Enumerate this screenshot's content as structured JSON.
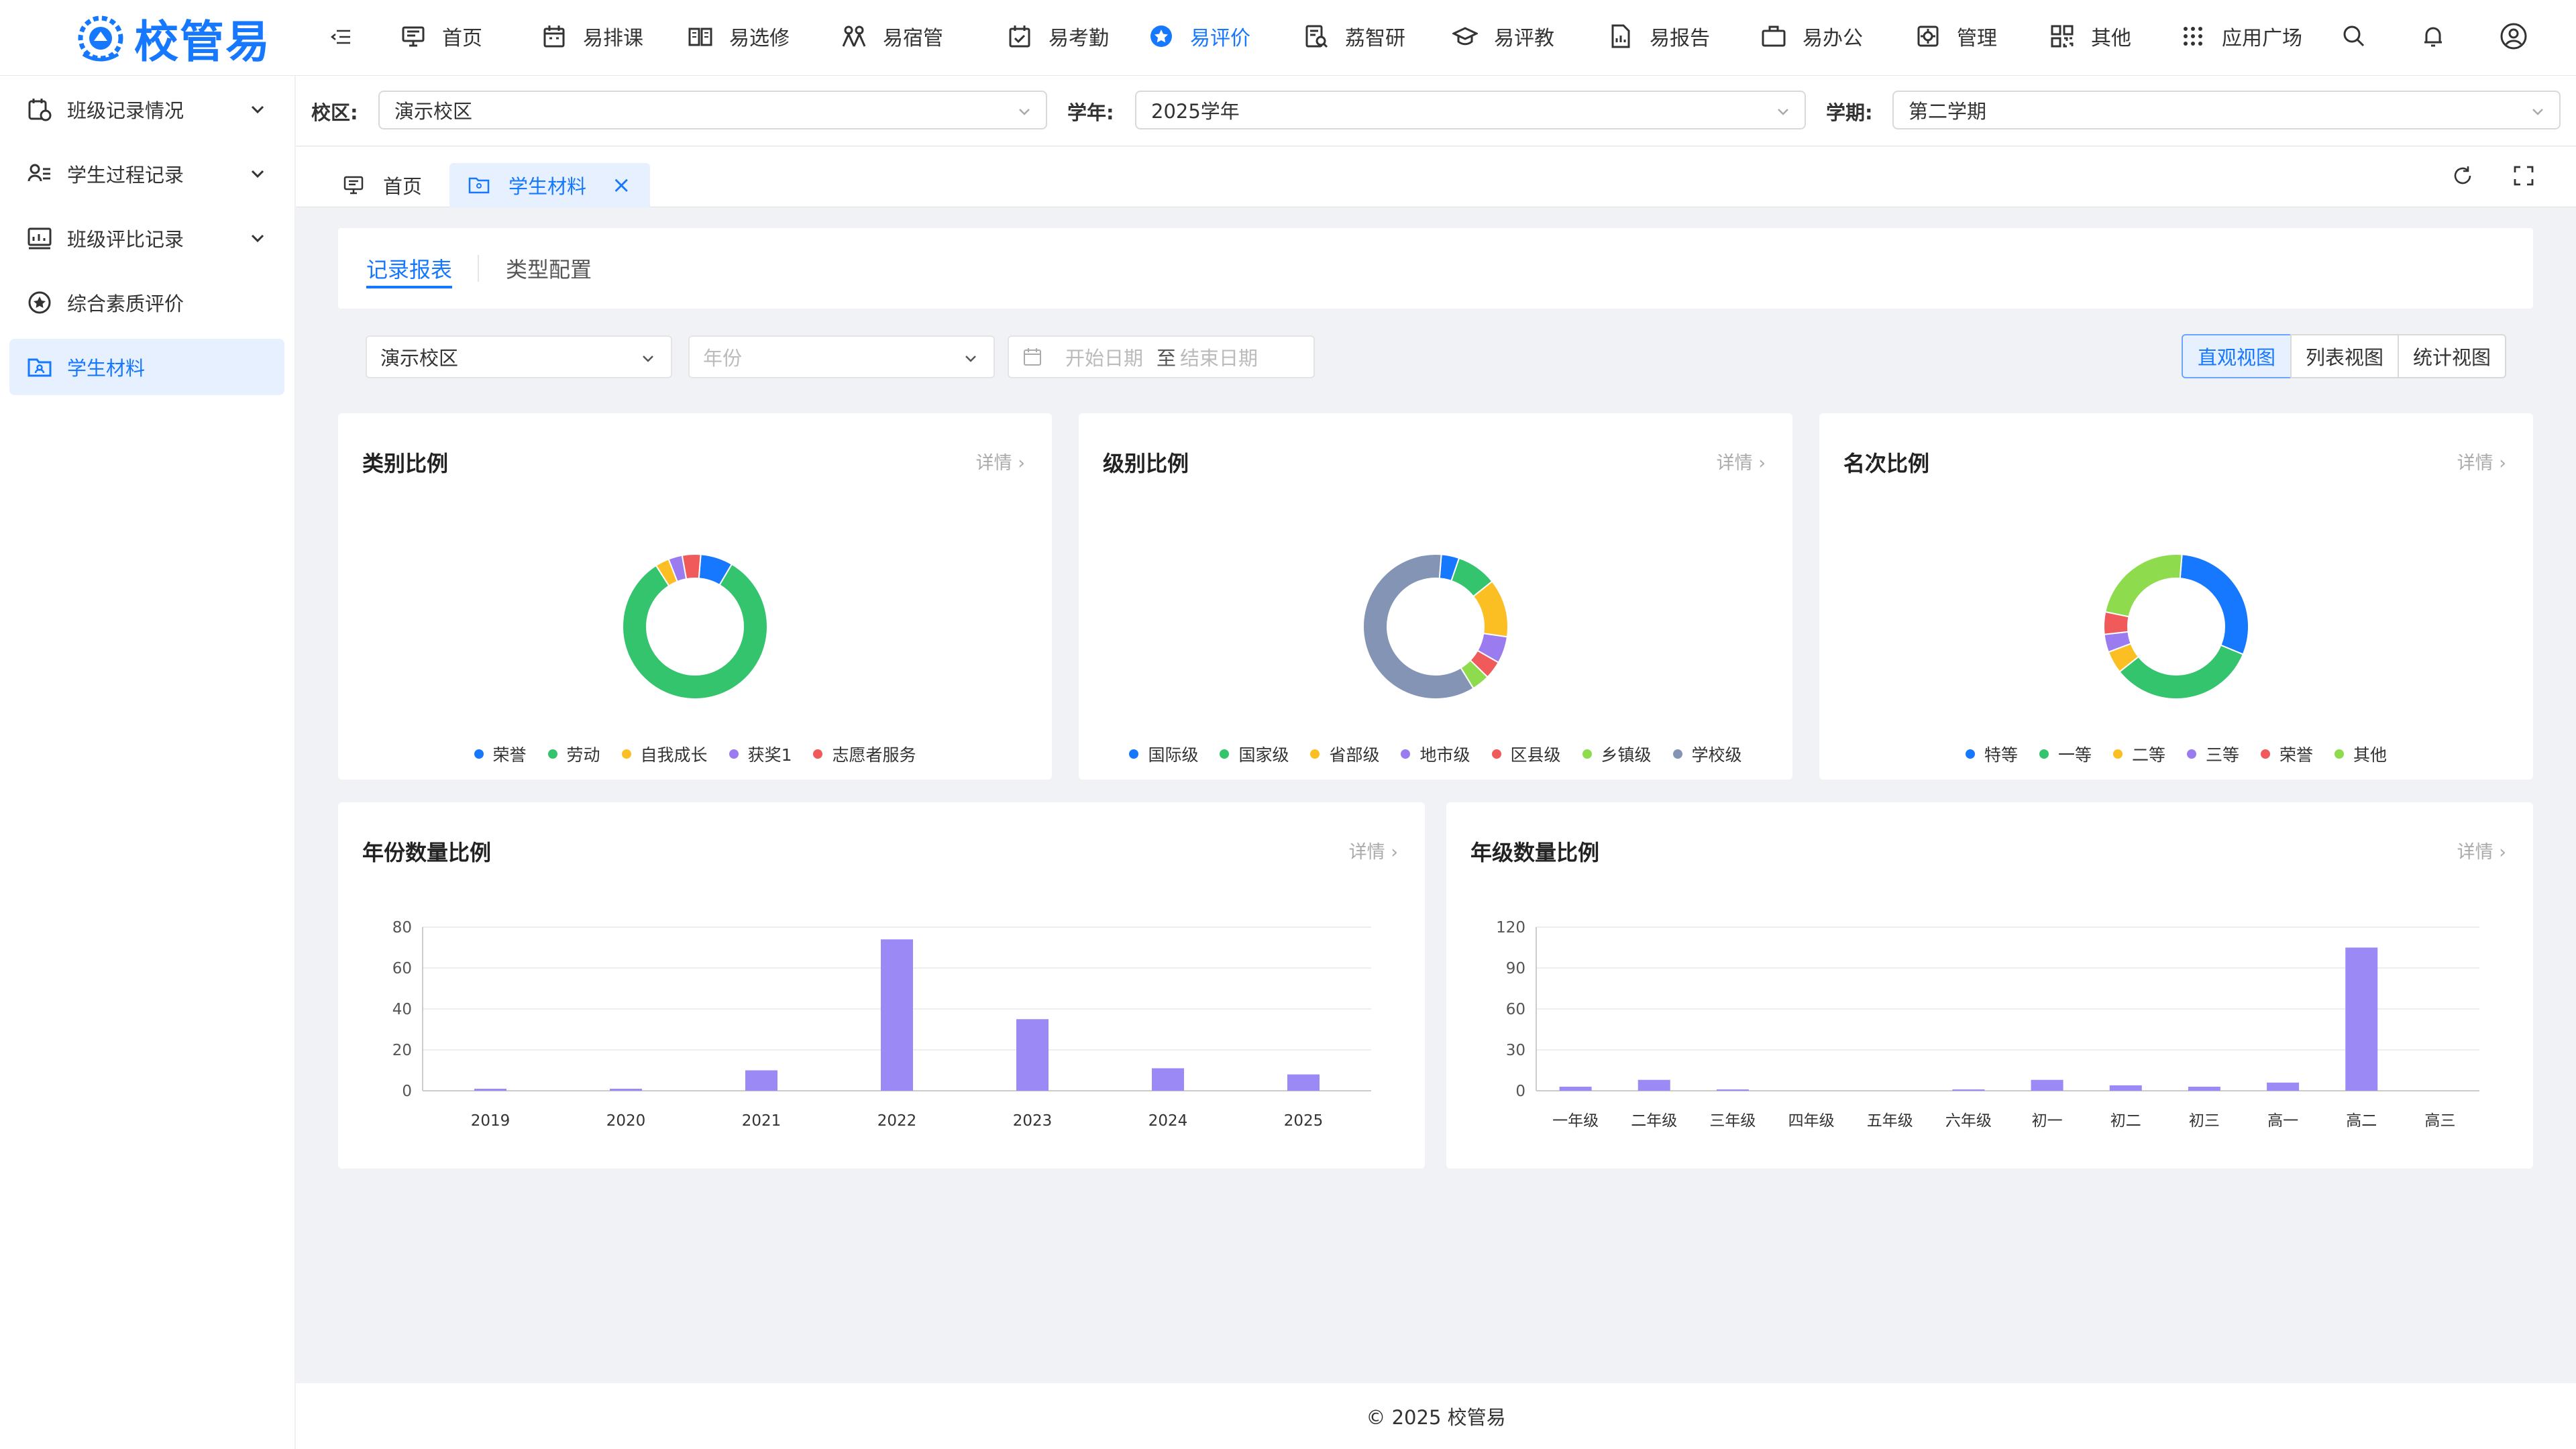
{
  "app": {
    "brand": "校管易"
  },
  "topnav": {
    "items": [
      {
        "label": "首页",
        "icon": "monitor-icon"
      },
      {
        "label": "易排课",
        "icon": "calendar-icon"
      },
      {
        "label": "易选修",
        "icon": "book-icon"
      },
      {
        "label": "易宿管",
        "icon": "dorm-icon"
      },
      {
        "label": "易考勤",
        "icon": "calendar-check-icon"
      },
      {
        "label": "易评价",
        "icon": "star-circle-icon"
      },
      {
        "label": "荔智研",
        "icon": "research-icon"
      },
      {
        "label": "易评教",
        "icon": "graduation-cap-icon"
      },
      {
        "label": "易报告",
        "icon": "report-icon"
      },
      {
        "label": "易办公",
        "icon": "briefcase-icon"
      },
      {
        "label": "管理",
        "icon": "gear-icon"
      },
      {
        "label": "其他",
        "icon": "grid-icon"
      },
      {
        "label": "应用广场",
        "icon": "apps-icon"
      }
    ]
  },
  "sidebar": {
    "items": [
      {
        "label": "班级记录情况"
      },
      {
        "label": "学生过程记录"
      },
      {
        "label": "班级评比记录"
      },
      {
        "label": "综合素质评价"
      },
      {
        "label": "学生材料"
      }
    ]
  },
  "filterbar": {
    "campus_label": "校区:",
    "campus_value": "演示校区",
    "year_label": "学年:",
    "year_value": "2025学年",
    "term_label": "学期:",
    "term_value": "第二学期"
  },
  "pagetabs": {
    "home": "首页",
    "current": "学生材料"
  },
  "subtabs": {
    "records": "记录报表",
    "config": "类型配置"
  },
  "filters": {
    "campus": "演示校区",
    "year_placeholder": "年份",
    "start_placeholder": "开始日期",
    "sep": "至",
    "end_placeholder": "结束日期",
    "views": [
      "直观视图",
      "列表视图",
      "统计视图"
    ]
  },
  "cards": {
    "category": {
      "title": "类别比例"
    },
    "level": {
      "title": "级别比例"
    },
    "rank": {
      "title": "名次比例"
    },
    "year_count": {
      "title": "年份数量比例"
    },
    "grade_count": {
      "title": "年级数量比例"
    },
    "detail": "详情"
  },
  "chart_data": [
    {
      "type": "pie",
      "title": "类别比例",
      "labels": [
        "荣誉",
        "劳动",
        "自我成长",
        "获奖1",
        "志愿者服务"
      ],
      "values": [
        7,
        80,
        3,
        3,
        4
      ],
      "colors": [
        "#1677ff",
        "#34c46d",
        "#fbbf24",
        "#9b7cf0",
        "#f05a5a"
      ]
    },
    {
      "type": "pie",
      "title": "级别比例",
      "labels": [
        "国际级",
        "国家级",
        "省部级",
        "地市级",
        "区县级",
        "乡镇级",
        "学校级"
      ],
      "values": [
        4,
        9,
        13,
        6,
        4,
        4,
        60
      ],
      "colors": [
        "#1677ff",
        "#34c46d",
        "#fbbf24",
        "#9b7cf0",
        "#f05a5a",
        "#8edc4e",
        "#8494b4"
      ]
    },
    {
      "type": "pie",
      "title": "名次比例",
      "labels": [
        "特等",
        "一等",
        "二等",
        "三等",
        "荣誉",
        "其他"
      ],
      "values": [
        30,
        33,
        5,
        4,
        5,
        23
      ],
      "colors": [
        "#1677ff",
        "#34c46d",
        "#fbbf24",
        "#9b7cf0",
        "#f05a5a",
        "#8edc4e"
      ]
    },
    {
      "type": "bar",
      "title": "年份数量比例",
      "categories": [
        "2019",
        "2020",
        "2021",
        "2022",
        "2023",
        "2024",
        "2025"
      ],
      "values": [
        1,
        1,
        10,
        74,
        35,
        11,
        8
      ],
      "ylim": [
        0,
        80
      ],
      "yticks": [
        0,
        20,
        40,
        60,
        80
      ],
      "color": "#9b8af5"
    },
    {
      "type": "bar",
      "title": "年级数量比例",
      "categories": [
        "一年级",
        "二年级",
        "三年级",
        "四年级",
        "五年级",
        "六年级",
        "初一",
        "初二",
        "初三",
        "高一",
        "高二",
        "高三"
      ],
      "values": [
        3,
        8,
        1,
        0,
        0,
        1,
        8,
        4,
        3,
        6,
        105,
        0
      ],
      "ylim": [
        0,
        120
      ],
      "yticks": [
        0,
        30,
        60,
        90,
        120
      ],
      "color": "#9b8af5"
    }
  ],
  "footer": {
    "text": "© 2025 校管易"
  }
}
